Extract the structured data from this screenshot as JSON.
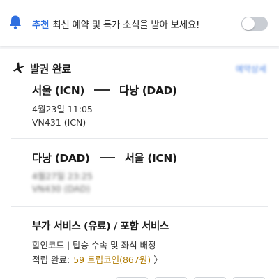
{
  "banner": {
    "tag": "추천",
    "message": "최신 예약 및 특가 소식을 받아 보세요!",
    "toggle_on": false
  },
  "card": {
    "title": "발권 완료",
    "detail_link": "예약상세"
  },
  "segments": [
    {
      "from": "서울 (ICN)",
      "to": "다낭 (DAD)",
      "datetime": "4월23일 11:05",
      "flight": "VN431 (ICN)"
    },
    {
      "from": "다낭 (DAD)",
      "to": "서울 (ICN)",
      "datetime": "4월27일 23:25",
      "flight": "VN430 (DAD)"
    }
  ],
  "extras": {
    "title": "부가 서비스 (유료) / 포함 서비스",
    "subtitle": "할인코드 | 탑승 수속 및 좌석 배정",
    "points_label": "적립 완료:",
    "points_value": "59 트립코인(867원)",
    "chevron": "〉"
  },
  "colors": {
    "accent": "#2f6fe0",
    "points": "#b07a00",
    "toggle_off": "#c9cdd3"
  },
  "icons": {
    "bell": "bell-icon",
    "plane": "airplane-icon",
    "arrow": "route-arrow-icon"
  }
}
